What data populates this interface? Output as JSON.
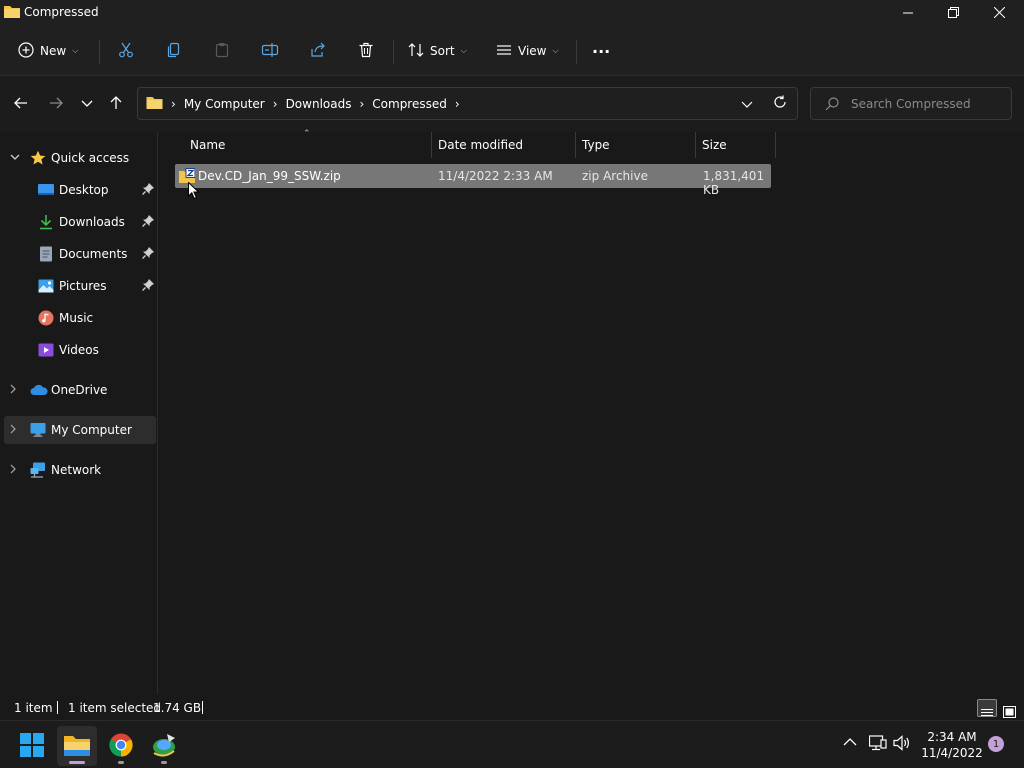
{
  "window": {
    "title": "Compressed"
  },
  "toolbar": {
    "new_label": "New",
    "sort_label": "Sort",
    "view_label": "View",
    "more_label": "···"
  },
  "address": {
    "crumbs": [
      "My Computer",
      "Downloads",
      "Compressed"
    ]
  },
  "search": {
    "placeholder": "Search Compressed"
  },
  "sidebar": {
    "items": [
      {
        "label": "Quick access",
        "icon": "star-icon"
      },
      {
        "label": "Desktop",
        "icon": "desktop-icon",
        "pinned": true
      },
      {
        "label": "Downloads",
        "icon": "download-icon",
        "pinned": true
      },
      {
        "label": "Documents",
        "icon": "document-icon",
        "pinned": true
      },
      {
        "label": "Pictures",
        "icon": "pictures-icon",
        "pinned": true
      },
      {
        "label": "Music",
        "icon": "music-icon"
      },
      {
        "label": "Videos",
        "icon": "videos-icon"
      },
      {
        "label": "OneDrive",
        "icon": "cloud-icon"
      },
      {
        "label": "My Computer",
        "icon": "computer-icon",
        "selected": true
      },
      {
        "label": "Network",
        "icon": "network-icon"
      }
    ]
  },
  "columns": {
    "name": "Name",
    "date": "Date modified",
    "type": "Type",
    "size": "Size"
  },
  "files": [
    {
      "name": "Dev.CD_Jan_99_SSW.zip",
      "date": "11/4/2022 2:33 AM",
      "type": "zip Archive",
      "size": "1,831,401 KB"
    }
  ],
  "status": {
    "count": "1 item",
    "selected": "1 item selected",
    "size": "1.74 GB"
  },
  "taskbar": {
    "time": "2:34 AM",
    "date": "11/4/2022",
    "notifications": "1"
  },
  "colors": {
    "folder": "#f0c54a",
    "accent": "#4cc2ff",
    "selection": "#777777"
  }
}
